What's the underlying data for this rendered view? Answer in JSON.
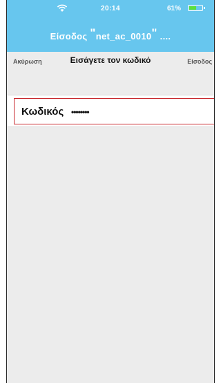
{
  "status_bar": {
    "time": "20:14",
    "battery_percent": "61%",
    "battery_level": 0.61,
    "battery_fill_color": "#5ce03a"
  },
  "nav": {
    "title_prefix": "Είσοδος ",
    "quote_open": "\"",
    "network_name": "net_ac_0010",
    "quote_close": "\"",
    "title_suffix": " ...."
  },
  "action_bar": {
    "cancel_label": "Ακύρωση",
    "title": "Εισάγετε τον κωδικό",
    "login_label": "Είσοδος"
  },
  "password_field": {
    "label": "Κωδικός",
    "value": "••••••••"
  },
  "colors": {
    "header": "#67c6ee",
    "field_border": "#c8282e",
    "background": "#ececec"
  }
}
